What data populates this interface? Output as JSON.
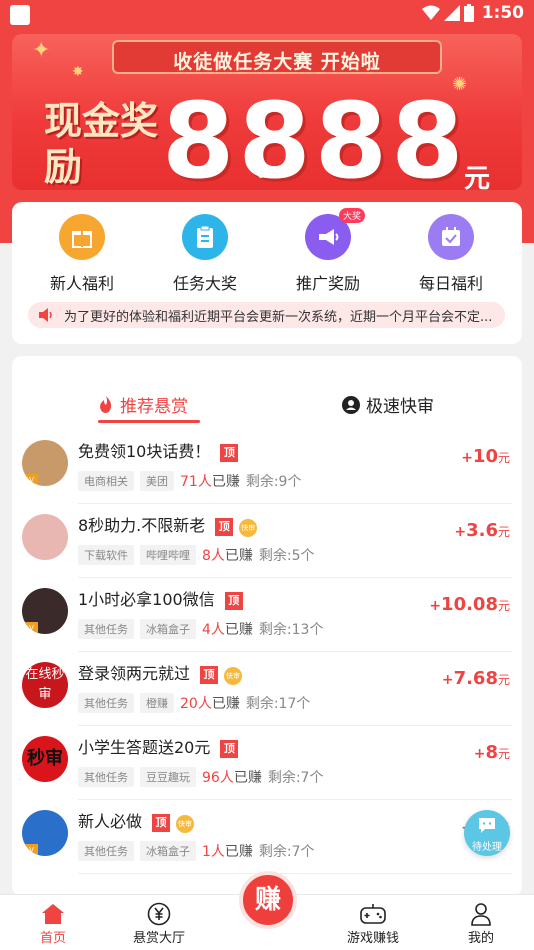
{
  "status_bar": {
    "time": "1:50"
  },
  "banner": {
    "title": "收徒做任务大赛 开始啦",
    "cash_label": "现金奖励",
    "amount": "8888",
    "unit": "元"
  },
  "quick_actions": [
    {
      "label": "新人福利",
      "icon": "gift-icon",
      "color": "#f7a630"
    },
    {
      "label": "任务大奖",
      "icon": "clipboard-icon",
      "color": "#2db4e8"
    },
    {
      "label": "推广奖励",
      "icon": "megaphone-icon",
      "color": "#8a5cf0",
      "badge": "大奖"
    },
    {
      "label": "每日福利",
      "icon": "calendar-check-icon",
      "color": "#9b7cf2"
    }
  ],
  "notice": {
    "text": "为了更好的体验和福利近期平台会更新一次系统，近期一个月平台会不定..."
  },
  "tabs": {
    "recommended": "推荐悬赏",
    "fast_review": "极速快审"
  },
  "tasks": [
    {
      "title": "免费领10块话费！",
      "ding": "顶",
      "fast": "",
      "tags": [
        "电商相关",
        "美团"
      ],
      "earned_count": "71人",
      "earned_suffix": "已赚",
      "remaining": "剩余:9个",
      "reward": "10",
      "avatar_color": "#c89a6a"
    },
    {
      "title": "8秒助力.不限新老",
      "ding": "顶",
      "fast": "快审",
      "tags": [
        "下载软件",
        "哔哩哔哩"
      ],
      "earned_count": "8人",
      "earned_suffix": "已赚",
      "remaining": "剩余:5个",
      "reward": "3.6",
      "avatar_color": "#e9b7b2"
    },
    {
      "title": "1小时必拿100微信",
      "ding": "顶",
      "fast": "",
      "tags": [
        "其他任务",
        "冰箱盒子"
      ],
      "earned_count": "4人",
      "earned_suffix": "已赚",
      "remaining": "剩余:13个",
      "reward": "10.08",
      "avatar_color": "#3a2a2a"
    },
    {
      "title": "登录领两元就过",
      "ding": "顶",
      "fast": "快审",
      "tags": [
        "其他任务",
        "橙赚"
      ],
      "earned_count": "20人",
      "earned_suffix": "已赚",
      "remaining": "剩余:17个",
      "reward": "7.68",
      "avatar_color": "#c8161d",
      "avatar_text": "在线秒审"
    },
    {
      "title": "小学生答题送20元",
      "ding": "顶",
      "fast": "",
      "tags": [
        "其他任务",
        "豆豆趣玩"
      ],
      "earned_count": "96人",
      "earned_suffix": "已赚",
      "remaining": "剩余:7个",
      "reward": "8",
      "avatar_color": "#d9141b",
      "avatar_text": "秒审"
    },
    {
      "title": "新人必做",
      "ding": "顶",
      "fast": "快审",
      "tags": [
        "其他任务",
        "冰箱盒子"
      ],
      "earned_count": "1人",
      "earned_suffix": "已赚",
      "remaining": "剩余:7个",
      "reward": "10",
      "avatar_color": "#2a6fc9"
    }
  ],
  "reward_prefix": "+",
  "reward_unit": "元",
  "float_button": {
    "label": "待处理"
  },
  "bottom_nav": {
    "home": "首页",
    "bounty_hall": "悬赏大厅",
    "earn": "赚",
    "game_earn": "游戏赚钱",
    "mine": "我的"
  }
}
